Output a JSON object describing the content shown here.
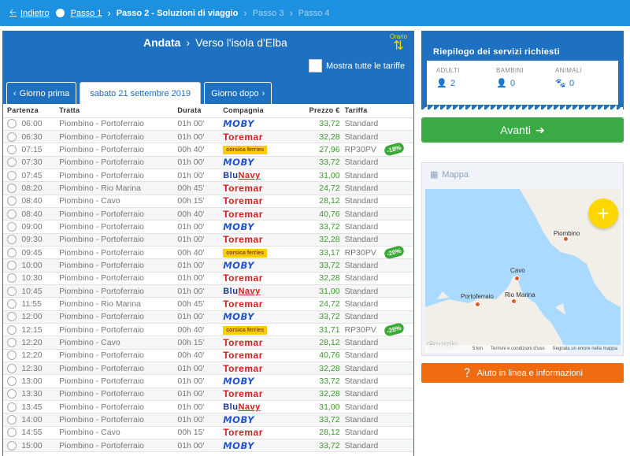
{
  "nav": {
    "back_label": "Indietro",
    "steps": [
      "Passo 1",
      "Passo 2 - Soluzioni di viaggio",
      "Passo 3",
      "Passo 4"
    ]
  },
  "direction": {
    "label": "Andata",
    "destination": "Verso l'isola d'Elba",
    "sort_label": "Orario",
    "show_all_label": "Mostra tutte le tariffe"
  },
  "tabs": {
    "prev": "Giorno prima",
    "current": "sabato 21 settembre 2019",
    "next": "Giorno dopo"
  },
  "columns": [
    "Partenza",
    "Tratta",
    "Durata",
    "Compagnia",
    "Prezzo €",
    "Tariffa"
  ],
  "trips": [
    {
      "dep": "06:00",
      "route": "Piombino - Portoferraio",
      "dur": "01h 00'",
      "company": "moby",
      "price": "33,72",
      "tariff": "Standard",
      "badge": ""
    },
    {
      "dep": "06:30",
      "route": "Piombino - Portoferraio",
      "dur": "01h 00'",
      "company": "toremar",
      "price": "32,28",
      "tariff": "Standard",
      "badge": ""
    },
    {
      "dep": "07:15",
      "route": "Piombino - Portoferraio",
      "dur": "00h 40'",
      "company": "corsica",
      "price": "27,96",
      "tariff": "RP30PV",
      "badge": "-18%"
    },
    {
      "dep": "07:30",
      "route": "Piombino - Portoferraio",
      "dur": "01h 00'",
      "company": "moby",
      "price": "33,72",
      "tariff": "Standard",
      "badge": ""
    },
    {
      "dep": "07:45",
      "route": "Piombino - Portoferraio",
      "dur": "01h 00'",
      "company": "blu",
      "price": "31,00",
      "tariff": "Standard",
      "badge": ""
    },
    {
      "dep": "08:20",
      "route": "Piombino - Rio Marina",
      "dur": "00h 45'",
      "company": "toremar",
      "price": "24,72",
      "tariff": "Standard",
      "badge": ""
    },
    {
      "dep": "08:40",
      "route": "Piombino - Cavo",
      "dur": "00h 15'",
      "company": "toremar",
      "price": "28,12",
      "tariff": "Standard",
      "badge": ""
    },
    {
      "dep": "08:40",
      "route": "Piombino - Portoferraio",
      "dur": "00h 40'",
      "company": "toremar",
      "price": "40,76",
      "tariff": "Standard",
      "badge": ""
    },
    {
      "dep": "09:00",
      "route": "Piombino - Portoferraio",
      "dur": "01h 00'",
      "company": "moby",
      "price": "33,72",
      "tariff": "Standard",
      "badge": ""
    },
    {
      "dep": "09:30",
      "route": "Piombino - Portoferraio",
      "dur": "01h 00'",
      "company": "toremar",
      "price": "32,28",
      "tariff": "Standard",
      "badge": ""
    },
    {
      "dep": "09:45",
      "route": "Piombino - Portoferraio",
      "dur": "00h 40'",
      "company": "corsica",
      "price": "33,17",
      "tariff": "RP30PV",
      "badge": "-20%"
    },
    {
      "dep": "10:00",
      "route": "Piombino - Portoferraio",
      "dur": "01h 00'",
      "company": "moby",
      "price": "33,72",
      "tariff": "Standard",
      "badge": ""
    },
    {
      "dep": "10:30",
      "route": "Piombino - Portoferraio",
      "dur": "01h 00'",
      "company": "toremar",
      "price": "32,28",
      "tariff": "Standard",
      "badge": ""
    },
    {
      "dep": "10:45",
      "route": "Piombino - Portoferraio",
      "dur": "01h 00'",
      "company": "blu",
      "price": "31,00",
      "tariff": "Standard",
      "badge": ""
    },
    {
      "dep": "11:55",
      "route": "Piombino - Rio Marina",
      "dur": "00h 45'",
      "company": "toremar",
      "price": "24,72",
      "tariff": "Standard",
      "badge": ""
    },
    {
      "dep": "12:00",
      "route": "Piombino - Portoferraio",
      "dur": "01h 00'",
      "company": "moby",
      "price": "33,72",
      "tariff": "Standard",
      "badge": ""
    },
    {
      "dep": "12:15",
      "route": "Piombino - Portoferraio",
      "dur": "00h 40'",
      "company": "corsica",
      "price": "31,71",
      "tariff": "RP30PV",
      "badge": "-20%"
    },
    {
      "dep": "12:20",
      "route": "Piombino - Cavo",
      "dur": "00h 15'",
      "company": "toremar",
      "price": "28,12",
      "tariff": "Standard",
      "badge": ""
    },
    {
      "dep": "12:20",
      "route": "Piombino - Portoferraio",
      "dur": "00h 40'",
      "company": "toremar",
      "price": "40,76",
      "tariff": "Standard",
      "badge": ""
    },
    {
      "dep": "12:30",
      "route": "Piombino - Portoferraio",
      "dur": "01h 00'",
      "company": "toremar",
      "price": "32,28",
      "tariff": "Standard",
      "badge": ""
    },
    {
      "dep": "13:00",
      "route": "Piombino - Portoferraio",
      "dur": "01h 00'",
      "company": "moby",
      "price": "33,72",
      "tariff": "Standard",
      "badge": ""
    },
    {
      "dep": "13:30",
      "route": "Piombino - Portoferraio",
      "dur": "01h 00'",
      "company": "toremar",
      "price": "32,28",
      "tariff": "Standard",
      "badge": ""
    },
    {
      "dep": "13:45",
      "route": "Piombino - Portoferraio",
      "dur": "01h 00'",
      "company": "blu",
      "price": "31,00",
      "tariff": "Standard",
      "badge": ""
    },
    {
      "dep": "14:00",
      "route": "Piombino - Portoferraio",
      "dur": "01h 00'",
      "company": "moby",
      "price": "33,72",
      "tariff": "Standard",
      "badge": ""
    },
    {
      "dep": "14:55",
      "route": "Piombino - Cavo",
      "dur": "00h 15'",
      "company": "toremar",
      "price": "28,12",
      "tariff": "Standard",
      "badge": ""
    },
    {
      "dep": "15:00",
      "route": "Piombino - Portoferraio",
      "dur": "01h 00'",
      "company": "moby",
      "price": "33,72",
      "tariff": "Standard",
      "badge": ""
    }
  ],
  "company_logos": {
    "moby": {
      "text": "MOBY"
    },
    "toremar": {
      "text": "Toremar"
    },
    "blu": {
      "text": "Blu",
      "suffix": "Navy"
    },
    "corsica": {
      "text": "corsica ferries"
    }
  },
  "summary": {
    "title": "Riepilogo dei servizi richiesti",
    "adults_label": "ADULTI",
    "adults": "2",
    "children_label": "BAMBINI",
    "children": "0",
    "animals_label": "ANIMALI",
    "animals": "0"
  },
  "avanti_label": "Avanti",
  "map": {
    "label": "Mappa",
    "places": [
      "Piombino",
      "Cavo",
      "Portoferraio",
      "Rio Marina"
    ],
    "scale": "5 km",
    "footer_terms": "Termini e condizioni d'uso",
    "footer_report": "Segnala un errore nella mappa",
    "brand": "Google"
  },
  "help_label": "Aiuto in linea e informazioni",
  "colors": {
    "primary": "#1e70c0",
    "topbar": "#1e90e0",
    "success": "#3aaa45",
    "help": "#f06a10",
    "price": "#3a9a2a",
    "accent_yellow": "#ffd700"
  }
}
